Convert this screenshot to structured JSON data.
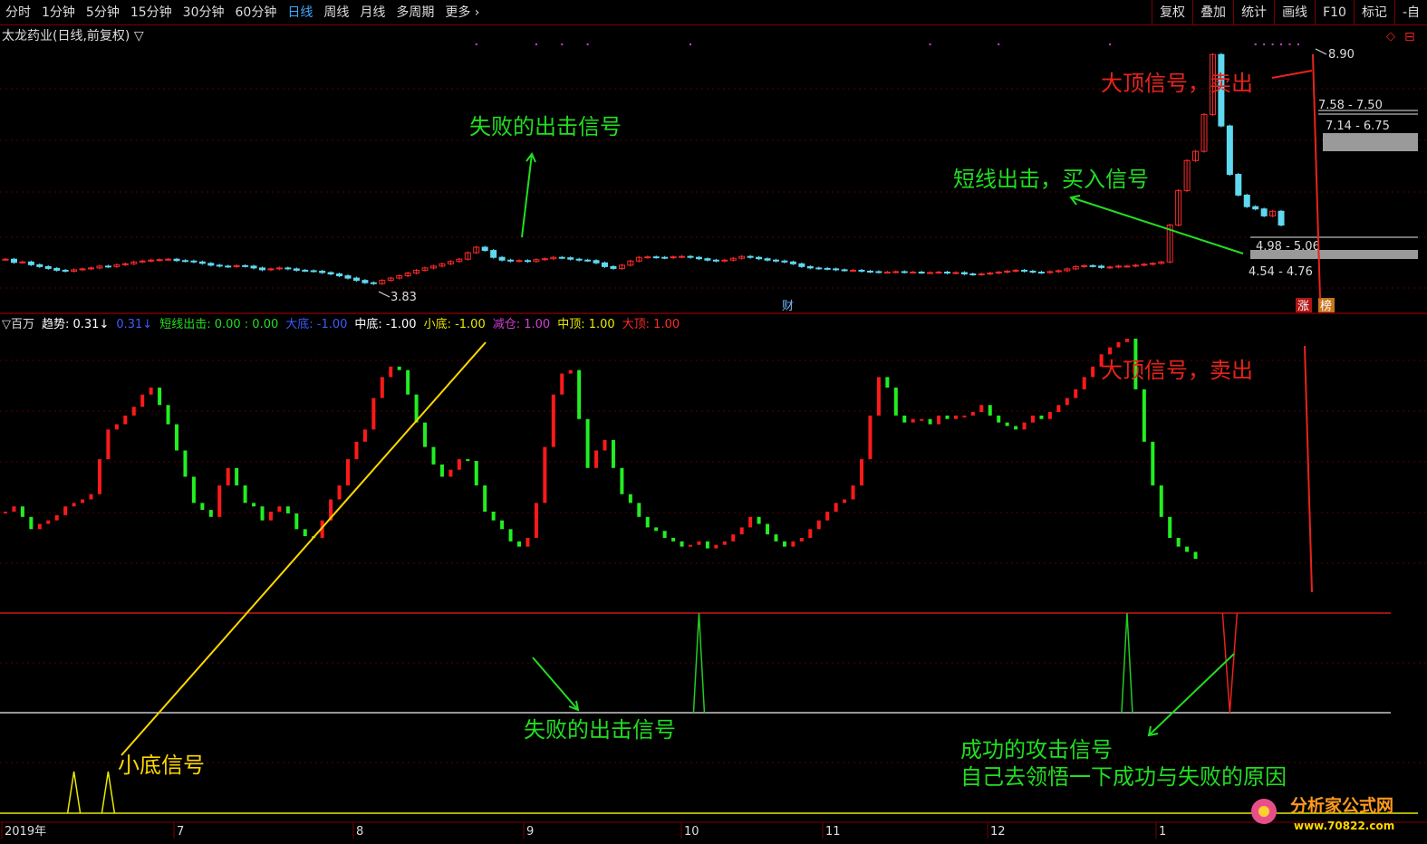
{
  "toolbar": {
    "periods": [
      "分时",
      "1分钟",
      "5分钟",
      "15分钟",
      "30分钟",
      "60分钟",
      "日线",
      "周线",
      "月线",
      "多周期",
      "更多 ›"
    ],
    "active_period": "日线",
    "right_tools": [
      "复权",
      "叠加",
      "统计",
      "画线",
      "F10",
      "标记",
      "-自"
    ]
  },
  "price_panel": {
    "title": "太龙药业(日线,前复权) ▽",
    "low_marker": "3.83",
    "high_marker": "8.90",
    "range_labels": [
      "7.58 - 7.50",
      "7.14 - 6.75",
      "4.98 - 5.06",
      "4.54 - 4.76"
    ],
    "event_labels": [
      "财",
      "涨",
      "榜"
    ],
    "annotations": {
      "top_signal": "大顶信号，卖出",
      "buy_signal": "短线出击，买入信号",
      "failed_signal": "失败的出击信号"
    }
  },
  "indicator_panel": {
    "legend": [
      {
        "text": "▽百万",
        "color": "#dddddd"
      },
      {
        "text": "趋势: 0.31↓",
        "color": "#ffffff"
      },
      {
        "text": "0.31↓",
        "color": "#3b5bff"
      },
      {
        "text": "短线出击: 0.00 : 0.00",
        "color": "#22dd22"
      },
      {
        "text": "大底: -1.00",
        "color": "#3b5bff"
      },
      {
        "text": "中底: -1.00",
        "color": "#ffffff"
      },
      {
        "text": "小底: -1.00",
        "color": "#e8e800"
      },
      {
        "text": "减仓: 1.00",
        "color": "#d040d0"
      },
      {
        "text": "中顶: 1.00",
        "color": "#e8e800"
      },
      {
        "text": "大顶: 1.00",
        "color": "#ff2a2a"
      }
    ],
    "annotations": {
      "top_signal": "大顶信号，卖出",
      "failed_signal": "失败的出击信号",
      "small_bottom": "小底信号",
      "success_line1": "成功的攻击信号",
      "success_line2": "自己去领悟一下成功与失败的原因"
    }
  },
  "date_axis": [
    "2019年",
    "7",
    "8",
    "9",
    "10",
    "11",
    "12",
    "1"
  ],
  "watermark": {
    "name": "分析家公式网",
    "url": "www.70822.com"
  },
  "colors": {
    "up": "#ff2a2a",
    "down": "#22ee22",
    "annotation_red": "#e8231c",
    "annotation_green": "#22dd22",
    "annotation_yellow": "#ffd700",
    "frame": "#7a0000"
  },
  "chart_data": {
    "type": "candlestick",
    "price_range": [
      3.6,
      9.1
    ],
    "price": [
      4.46,
      4.39,
      4.4,
      4.34,
      4.3,
      4.26,
      4.22,
      4.2,
      4.23,
      4.25,
      4.27,
      4.31,
      4.3,
      4.34,
      4.36,
      4.4,
      4.42,
      4.44,
      4.45,
      4.46,
      4.43,
      4.42,
      4.4,
      4.37,
      4.33,
      4.31,
      4.3,
      4.32,
      4.31,
      4.27,
      4.23,
      4.25,
      4.27,
      4.25,
      4.22,
      4.21,
      4.2,
      4.17,
      4.14,
      4.1,
      4.05,
      4.0,
      3.95,
      3.93,
      4.0,
      4.05,
      4.1,
      4.16,
      4.22,
      4.27,
      4.31,
      4.36,
      4.41,
      4.46,
      4.6,
      4.72,
      4.65,
      4.5,
      4.44,
      4.42,
      4.43,
      4.41,
      4.45,
      4.47,
      4.5,
      4.49,
      4.46,
      4.44,
      4.43,
      4.38,
      4.3,
      4.26,
      4.33,
      4.42,
      4.5,
      4.51,
      4.5,
      4.49,
      4.51,
      4.52,
      4.5,
      4.47,
      4.44,
      4.42,
      4.44,
      4.48,
      4.52,
      4.5,
      4.47,
      4.44,
      4.42,
      4.4,
      4.36,
      4.3,
      4.27,
      4.26,
      4.25,
      4.23,
      4.22,
      4.22,
      4.2,
      4.19,
      4.18,
      4.18,
      4.19,
      4.18,
      4.18,
      4.17,
      4.17,
      4.18,
      4.16,
      4.17,
      4.14,
      4.13,
      4.14,
      4.16,
      4.18,
      4.2,
      4.22,
      4.2,
      4.18,
      4.17,
      4.19,
      4.21,
      4.25,
      4.3,
      4.32,
      4.31,
      4.28,
      4.29,
      4.31,
      4.31,
      4.33,
      4.35,
      4.37,
      4.4,
      5.2,
      5.95,
      6.6,
      6.8,
      7.6,
      8.9,
      7.35,
      6.3,
      5.85,
      5.6,
      5.55,
      5.4,
      5.5,
      5.2
    ],
    "indicator_range": [
      -1.1,
      1.05
    ],
    "trend": [
      0.05,
      0.08,
      0.02,
      -0.05,
      -0.02,
      0.0,
      0.03,
      0.08,
      0.1,
      0.12,
      0.15,
      0.35,
      0.52,
      0.55,
      0.6,
      0.65,
      0.72,
      0.76,
      0.66,
      0.55,
      0.4,
      0.25,
      0.1,
      0.06,
      0.02,
      0.2,
      0.3,
      0.2,
      0.1,
      0.08,
      0.0,
      0.05,
      0.08,
      0.04,
      -0.05,
      -0.09,
      -0.1,
      0.0,
      0.12,
      0.2,
      0.35,
      0.45,
      0.52,
      0.7,
      0.82,
      0.88,
      0.86,
      0.72,
      0.56,
      0.42,
      0.32,
      0.25,
      0.29,
      0.35,
      0.34,
      0.2,
      0.05,
      0.0,
      -0.05,
      -0.12,
      -0.15,
      -0.1,
      0.1,
      0.42,
      0.72,
      0.84,
      0.86,
      0.58,
      0.3,
      0.4,
      0.46,
      0.3,
      0.15,
      0.1,
      0.02,
      -0.04,
      -0.06,
      -0.1,
      -0.12,
      -0.15,
      -0.14,
      -0.12,
      -0.16,
      -0.14,
      -0.12,
      -0.08,
      -0.04,
      0.02,
      -0.02,
      -0.08,
      -0.12,
      -0.15,
      -0.12,
      -0.1,
      -0.05,
      0.0,
      0.05,
      0.1,
      0.12,
      0.2,
      0.35,
      0.6,
      0.82,
      0.76,
      0.6,
      0.56,
      0.58,
      0.58,
      0.55,
      0.6,
      0.58,
      0.6,
      0.6,
      0.62,
      0.66,
      0.6,
      0.56,
      0.54,
      0.52,
      0.56,
      0.6,
      0.58,
      0.62,
      0.66,
      0.7,
      0.75,
      0.82,
      0.88,
      0.95,
      0.99,
      1.02,
      1.04,
      0.75,
      0.45,
      0.2,
      0.02,
      -0.1,
      -0.15,
      -0.18,
      -0.22
    ],
    "signal_indices": [
      81,
      131,
      143
    ],
    "small_bottom_indices": [
      8,
      12
    ]
  }
}
